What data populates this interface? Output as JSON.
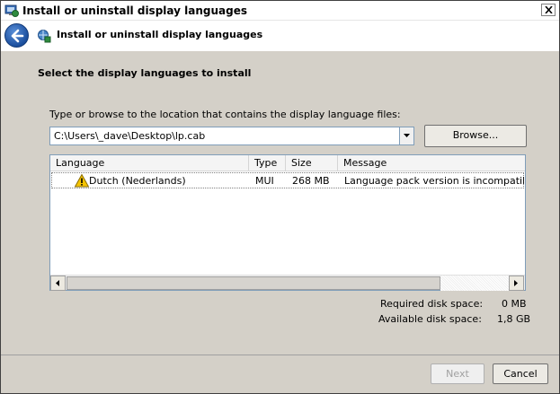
{
  "window": {
    "title": "Install or uninstall display languages",
    "close_icon": "close-icon"
  },
  "nav": {
    "back_icon": "back-arrow-icon",
    "title": "Install or uninstall display languages"
  },
  "content": {
    "heading": "Select the display languages to install",
    "path_label": "Type or browse to the location that contains the display language files:",
    "path_value": "C:\\Users\\_dave\\Desktop\\lp.cab",
    "browse_label": "Browse..."
  },
  "table": {
    "columns": [
      "Language",
      "Type",
      "Size",
      "Message"
    ],
    "rows": [
      {
        "language": "Dutch (Nederlands)",
        "type": "MUI",
        "size": "268 MB",
        "message": "Language pack version is incompatibl",
        "icon": "warning-icon"
      }
    ]
  },
  "disk": {
    "required_label": "Required disk space:",
    "required_value": "0 MB",
    "available_label": "Available disk space:",
    "available_value": "1,8 GB"
  },
  "footer": {
    "next_label": "Next",
    "cancel_label": "Cancel"
  }
}
